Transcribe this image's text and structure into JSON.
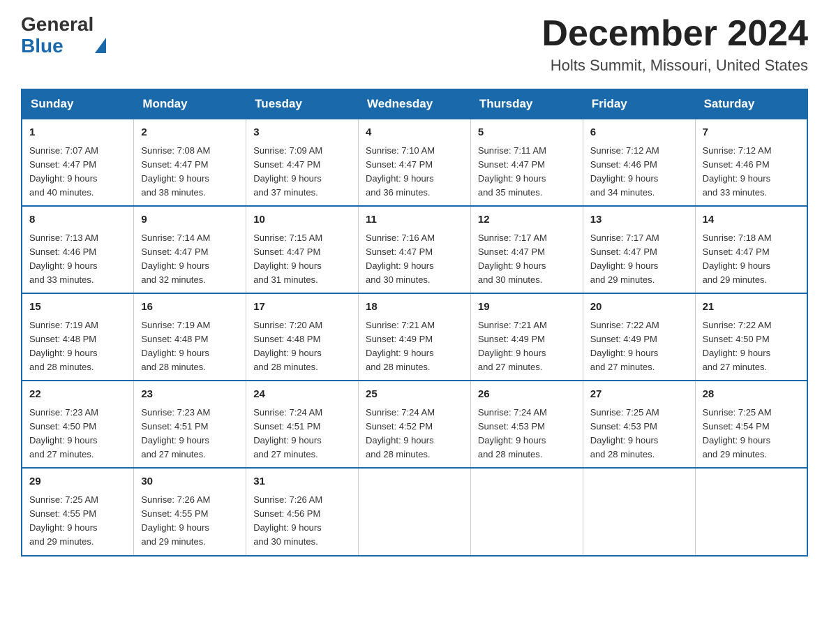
{
  "header": {
    "logo": {
      "general": "General",
      "blue": "Blue",
      "aria": "GeneralBlue logo"
    },
    "title": "December 2024",
    "location": "Holts Summit, Missouri, United States"
  },
  "calendar": {
    "weekdays": [
      "Sunday",
      "Monday",
      "Tuesday",
      "Wednesday",
      "Thursday",
      "Friday",
      "Saturday"
    ],
    "weeks": [
      [
        {
          "day": "1",
          "sunrise": "7:07 AM",
          "sunset": "4:47 PM",
          "daylight": "9 hours and 40 minutes."
        },
        {
          "day": "2",
          "sunrise": "7:08 AM",
          "sunset": "4:47 PM",
          "daylight": "9 hours and 38 minutes."
        },
        {
          "day": "3",
          "sunrise": "7:09 AM",
          "sunset": "4:47 PM",
          "daylight": "9 hours and 37 minutes."
        },
        {
          "day": "4",
          "sunrise": "7:10 AM",
          "sunset": "4:47 PM",
          "daylight": "9 hours and 36 minutes."
        },
        {
          "day": "5",
          "sunrise": "7:11 AM",
          "sunset": "4:47 PM",
          "daylight": "9 hours and 35 minutes."
        },
        {
          "day": "6",
          "sunrise": "7:12 AM",
          "sunset": "4:46 PM",
          "daylight": "9 hours and 34 minutes."
        },
        {
          "day": "7",
          "sunrise": "7:12 AM",
          "sunset": "4:46 PM",
          "daylight": "9 hours and 33 minutes."
        }
      ],
      [
        {
          "day": "8",
          "sunrise": "7:13 AM",
          "sunset": "4:46 PM",
          "daylight": "9 hours and 33 minutes."
        },
        {
          "day": "9",
          "sunrise": "7:14 AM",
          "sunset": "4:47 PM",
          "daylight": "9 hours and 32 minutes."
        },
        {
          "day": "10",
          "sunrise": "7:15 AM",
          "sunset": "4:47 PM",
          "daylight": "9 hours and 31 minutes."
        },
        {
          "day": "11",
          "sunrise": "7:16 AM",
          "sunset": "4:47 PM",
          "daylight": "9 hours and 30 minutes."
        },
        {
          "day": "12",
          "sunrise": "7:17 AM",
          "sunset": "4:47 PM",
          "daylight": "9 hours and 30 minutes."
        },
        {
          "day": "13",
          "sunrise": "7:17 AM",
          "sunset": "4:47 PM",
          "daylight": "9 hours and 29 minutes."
        },
        {
          "day": "14",
          "sunrise": "7:18 AM",
          "sunset": "4:47 PM",
          "daylight": "9 hours and 29 minutes."
        }
      ],
      [
        {
          "day": "15",
          "sunrise": "7:19 AM",
          "sunset": "4:48 PM",
          "daylight": "9 hours and 28 minutes."
        },
        {
          "day": "16",
          "sunrise": "7:19 AM",
          "sunset": "4:48 PM",
          "daylight": "9 hours and 28 minutes."
        },
        {
          "day": "17",
          "sunrise": "7:20 AM",
          "sunset": "4:48 PM",
          "daylight": "9 hours and 28 minutes."
        },
        {
          "day": "18",
          "sunrise": "7:21 AM",
          "sunset": "4:49 PM",
          "daylight": "9 hours and 28 minutes."
        },
        {
          "day": "19",
          "sunrise": "7:21 AM",
          "sunset": "4:49 PM",
          "daylight": "9 hours and 27 minutes."
        },
        {
          "day": "20",
          "sunrise": "7:22 AM",
          "sunset": "4:49 PM",
          "daylight": "9 hours and 27 minutes."
        },
        {
          "day": "21",
          "sunrise": "7:22 AM",
          "sunset": "4:50 PM",
          "daylight": "9 hours and 27 minutes."
        }
      ],
      [
        {
          "day": "22",
          "sunrise": "7:23 AM",
          "sunset": "4:50 PM",
          "daylight": "9 hours and 27 minutes."
        },
        {
          "day": "23",
          "sunrise": "7:23 AM",
          "sunset": "4:51 PM",
          "daylight": "9 hours and 27 minutes."
        },
        {
          "day": "24",
          "sunrise": "7:24 AM",
          "sunset": "4:51 PM",
          "daylight": "9 hours and 27 minutes."
        },
        {
          "day": "25",
          "sunrise": "7:24 AM",
          "sunset": "4:52 PM",
          "daylight": "9 hours and 28 minutes."
        },
        {
          "day": "26",
          "sunrise": "7:24 AM",
          "sunset": "4:53 PM",
          "daylight": "9 hours and 28 minutes."
        },
        {
          "day": "27",
          "sunrise": "7:25 AM",
          "sunset": "4:53 PM",
          "daylight": "9 hours and 28 minutes."
        },
        {
          "day": "28",
          "sunrise": "7:25 AM",
          "sunset": "4:54 PM",
          "daylight": "9 hours and 29 minutes."
        }
      ],
      [
        {
          "day": "29",
          "sunrise": "7:25 AM",
          "sunset": "4:55 PM",
          "daylight": "9 hours and 29 minutes."
        },
        {
          "day": "30",
          "sunrise": "7:26 AM",
          "sunset": "4:55 PM",
          "daylight": "9 hours and 29 minutes."
        },
        {
          "day": "31",
          "sunrise": "7:26 AM",
          "sunset": "4:56 PM",
          "daylight": "9 hours and 30 minutes."
        },
        null,
        null,
        null,
        null
      ]
    ]
  },
  "labels": {
    "sunrise": "Sunrise: ",
    "sunset": "Sunset: ",
    "daylight": "Daylight: "
  }
}
